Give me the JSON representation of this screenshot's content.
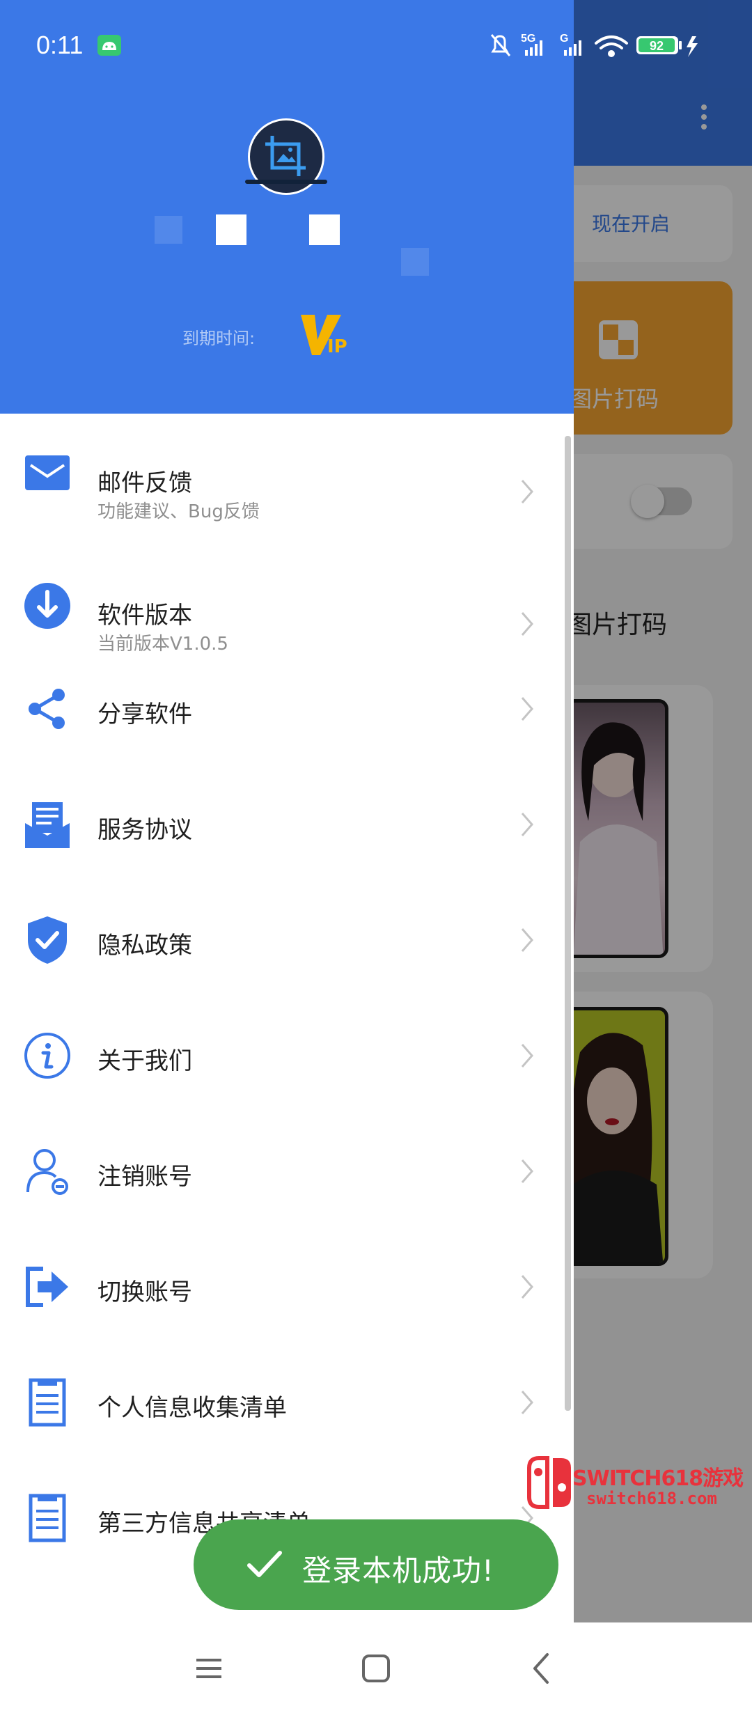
{
  "status_bar": {
    "time": "0:11",
    "network_1": "5G",
    "network_2": "G",
    "battery": "92"
  },
  "background_app": {
    "open_now_button": "现在开启",
    "mosaic_card_label": "图片打码",
    "section_title": "图片打码"
  },
  "drawer": {
    "expire_label": "到期时间:",
    "vip_badge": "VIP",
    "menu": [
      {
        "title": "邮件反馈",
        "subtitle": "功能建议、Bug反馈",
        "icon": "mail-icon"
      },
      {
        "title": "软件版本",
        "subtitle": "当前版本V1.0.5",
        "icon": "download-icon"
      },
      {
        "title": "分享软件",
        "subtitle": "",
        "icon": "share-icon"
      },
      {
        "title": "服务协议",
        "subtitle": "",
        "icon": "agreement-icon"
      },
      {
        "title": "隐私政策",
        "subtitle": "",
        "icon": "shield-check-icon"
      },
      {
        "title": "关于我们",
        "subtitle": "",
        "icon": "info-icon"
      },
      {
        "title": "注销账号",
        "subtitle": "",
        "icon": "user-remove-icon"
      },
      {
        "title": "切换账号",
        "subtitle": "",
        "icon": "switch-account-icon"
      },
      {
        "title": "个人信息收集清单",
        "subtitle": "",
        "icon": "list-document-icon"
      },
      {
        "title": "第三方信息共享清单",
        "subtitle": "",
        "icon": "list-document-icon"
      }
    ]
  },
  "toast": {
    "message": "登录本机成功!"
  },
  "watermark": {
    "title": "SWITCH618游戏",
    "url": "switch618.com"
  },
  "colors": {
    "primary": "#3b78e7",
    "toast_green": "#4aa54e",
    "orange": "#f7a631",
    "watermark_red": "#e8323c"
  }
}
